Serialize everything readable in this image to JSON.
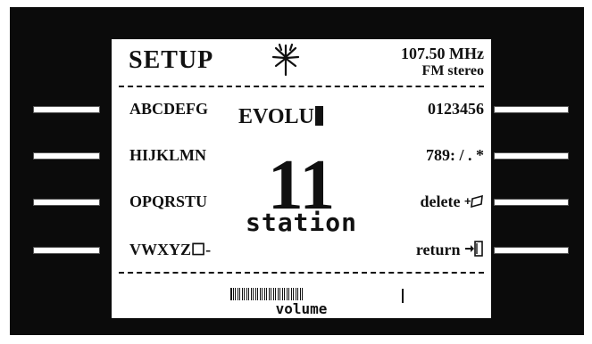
{
  "header": {
    "title": "SETUP",
    "frequency": "107.50 MHz",
    "mode": "FM stereo",
    "signal_icon": "antenna-burst-icon"
  },
  "keys_left": [
    "ABCDEFG",
    "HIJKLMN",
    "OPQRSTU",
    "VWXYZ☐-"
  ],
  "keys_right": [
    "0123456",
    "789: / . *"
  ],
  "actions": {
    "delete_label": "delete",
    "delete_icon": "backspace-icon",
    "return_label": "return",
    "return_icon": "exit-door-icon"
  },
  "edit_text": "EVOLU",
  "station": {
    "number": "11",
    "label": "station"
  },
  "volume": {
    "label": "volume",
    "level": 0.43
  },
  "colors": {
    "frame": "#0b0b0b",
    "screen": "#ffffff",
    "text": "#111111"
  }
}
